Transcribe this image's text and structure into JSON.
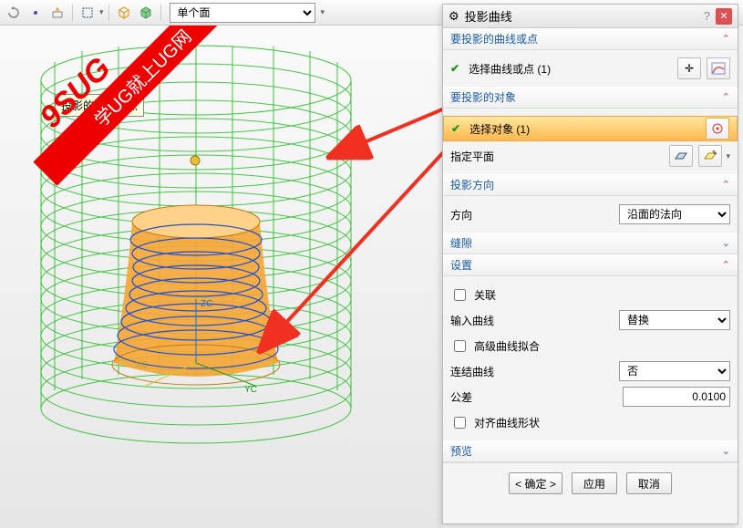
{
  "watermark": {
    "line1": "9SUG",
    "line2": "学UG就上UG网"
  },
  "toolbar": {
    "selector_mode": "单个面"
  },
  "tooltip": "投影的曲线或点",
  "panel": {
    "title": "投影曲线",
    "section_curves": "要投影的曲线或点",
    "select_curve": "选择曲线或点 (1)",
    "section_objects": "要投影的对象",
    "select_object": "选择对象 (1)",
    "specify_plane": "指定平面",
    "section_direction": "投影方向",
    "direction_label": "方向",
    "direction_value": "沿面的法向",
    "section_gap": "缝隙",
    "section_settings": "设置",
    "assoc": "关联",
    "input_curve_label": "输入曲线",
    "input_curve_value": "替换",
    "adv_fit": "高级曲线拟合",
    "join_label": "连结曲线",
    "join_value": "否",
    "tolerance_label": "公差",
    "tolerance_value": "0.0100",
    "align": "对齐曲线形状",
    "section_preview": "预览",
    "ok": "确定",
    "apply": "应用",
    "cancel": "取消"
  },
  "axes": {
    "z": "ZC",
    "y": "YC",
    "x": "XC"
  }
}
